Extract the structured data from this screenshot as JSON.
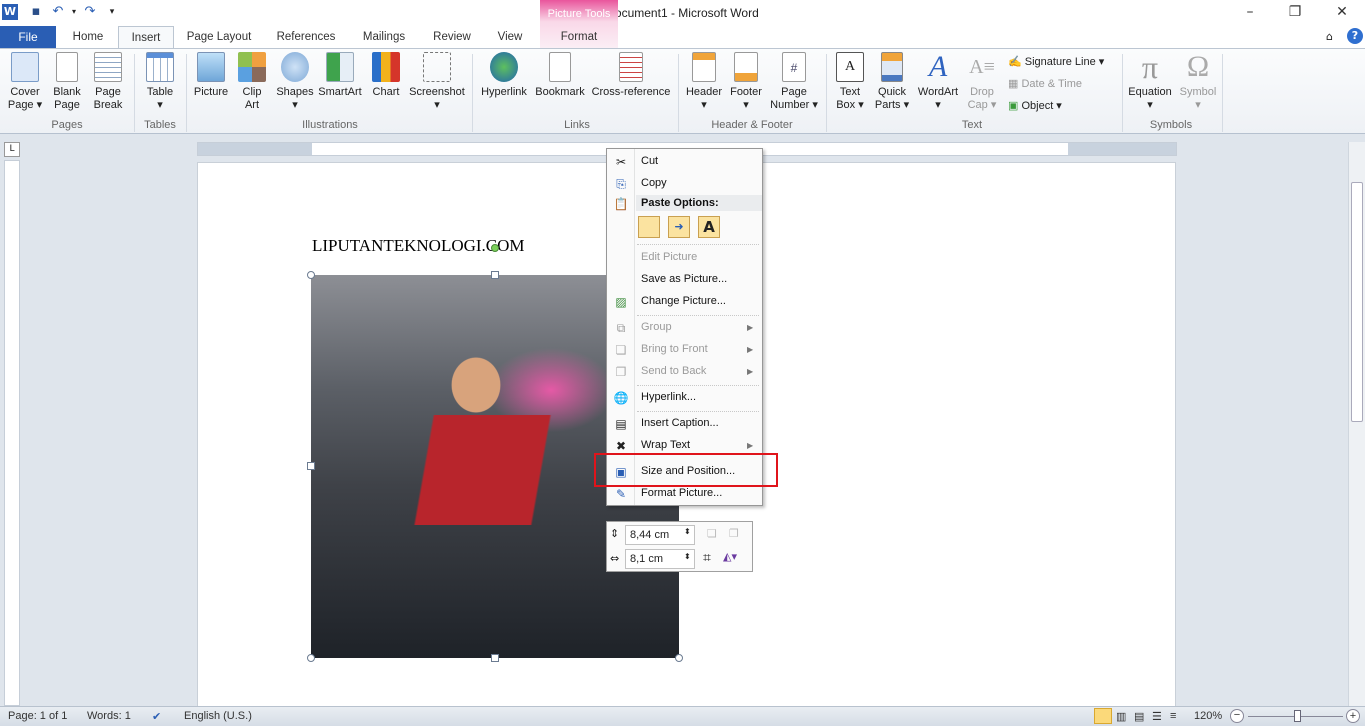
{
  "window": {
    "title": "Document1 - Microsoft Word",
    "contextual_group": "Picture Tools",
    "minimize": "–",
    "restore": "❐",
    "close": "✕"
  },
  "tabs": [
    "File",
    "Home",
    "Insert",
    "Page Layout",
    "References",
    "Mailings",
    "Review",
    "View",
    "Format"
  ],
  "active_tab": "Insert",
  "ribbon": {
    "groups": [
      "Pages",
      "Tables",
      "Illustrations",
      "Links",
      "Header & Footer",
      "Text",
      "Symbols"
    ],
    "buttons": {
      "cover_page": [
        "Cover",
        "Page ▾"
      ],
      "blank_page": [
        "Blank",
        "Page"
      ],
      "page_break": [
        "Page",
        "Break"
      ],
      "table": [
        "Table",
        "▾"
      ],
      "picture": [
        "Picture",
        ""
      ],
      "clip_art": [
        "Clip",
        "Art"
      ],
      "shapes": [
        "Shapes",
        "▾"
      ],
      "smartart": [
        "SmartArt",
        ""
      ],
      "chart": [
        "Chart",
        ""
      ],
      "screenshot": [
        "Screenshot",
        "▾"
      ],
      "hyperlink": [
        "Hyperlink",
        ""
      ],
      "bookmark": [
        "Bookmark",
        ""
      ],
      "cross_reference": [
        "Cross-reference",
        ""
      ],
      "header": [
        "Header",
        "▾"
      ],
      "footer": [
        "Footer",
        "▾"
      ],
      "page_number": [
        "Page",
        "Number ▾"
      ],
      "text_box": [
        "Text",
        "Box ▾"
      ],
      "quick_parts": [
        "Quick",
        "Parts ▾"
      ],
      "wordart": [
        "WordArt",
        "▾"
      ],
      "drop_cap": [
        "Drop",
        "Cap ▾"
      ],
      "equation": [
        "Equation",
        "▾"
      ],
      "symbol": [
        "Symbol",
        "▾"
      ]
    },
    "small": {
      "signature_line": "Signature Line ▾",
      "date_time": "Date & Time",
      "object": "Object ▾"
    }
  },
  "document": {
    "text": "LIPUTANTEKNOLOGI.COM"
  },
  "context_menu": {
    "cut": "Cut",
    "copy": "Copy",
    "paste_options": "Paste Options:",
    "edit_picture": "Edit Picture",
    "save_as_picture": "Save as Picture...",
    "change_picture": "Change Picture...",
    "group": "Group",
    "bring_to_front": "Bring to Front",
    "send_to_back": "Send to Back",
    "hyperlink": "Hyperlink...",
    "insert_caption": "Insert Caption...",
    "wrap_text": "Wrap Text",
    "size_and_position": "Size and Position...",
    "format_picture": "Format Picture...",
    "highlighted": "Size and Position..."
  },
  "mini_toolbar": {
    "height": "8,44 cm",
    "width": "8,1 cm"
  },
  "status": {
    "page": "Page: 1 of 1",
    "words": "Words: 1",
    "language": "English (U.S.)",
    "zoom": "120%",
    "zoom_level": 120
  },
  "colors": {
    "file_tab": "#2a5eb4",
    "picture_tools": "#e9559c",
    "highlight_box": "#e0141b"
  }
}
